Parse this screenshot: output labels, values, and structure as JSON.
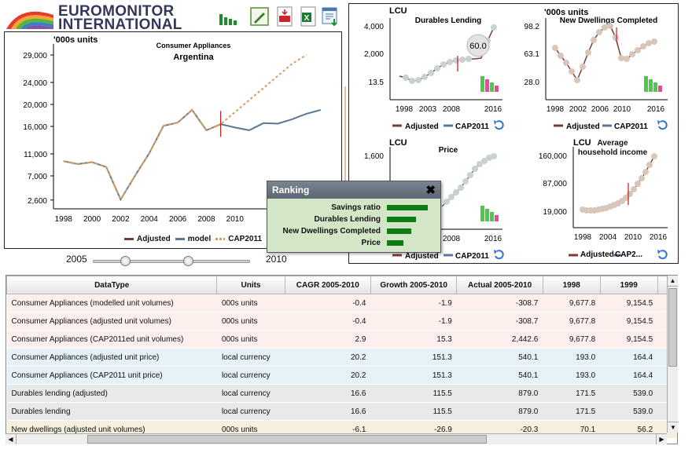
{
  "logo": {
    "line1": "EUROMONITOR",
    "line2": "INTERNATIONAL"
  },
  "toolbar": {
    "icons": [
      "bar-chart-icon",
      "edit-icon",
      "pdf-export-icon",
      "excel-export-icon",
      "download-icon"
    ]
  },
  "main_chart": {
    "unit": "'000s units",
    "title": "Consumer Appliances",
    "subtitle": "Argentina",
    "legend": [
      {
        "name": "Adjusted",
        "color": "#7e3a36"
      },
      {
        "name": "model",
        "color": "#5b7898"
      },
      {
        "name": "CAP2011",
        "color": "#d49a5c"
      }
    ]
  },
  "slider": {
    "from": "2005",
    "to": "2010",
    "handle_from_frac": 0.2,
    "handle_to_frac": 0.6
  },
  "ranking": {
    "title": "Ranking",
    "items": [
      {
        "label": "Savings ratio",
        "value": 1.0
      },
      {
        "label": "Durables Lending",
        "value": 0.72
      },
      {
        "label": "New Dwellings Completed",
        "value": 0.6
      },
      {
        "label": "Price",
        "value": 0.4
      }
    ]
  },
  "mini_charts": [
    {
      "unit": "LCU",
      "title": "Durables Lending",
      "yticks": [
        "4,000",
        "2,000",
        "13.5"
      ],
      "xticks": [
        "1998",
        "2003",
        "2008",
        "2016"
      ],
      "tooltip": "60.0",
      "legend": [
        "Adjusted",
        "CAP2011"
      ]
    },
    {
      "unit": "'000s units",
      "title": "New Dwellings Completed",
      "yticks": [
        "98.2",
        "63.1",
        "28.0"
      ],
      "xticks": [
        "1998",
        "2002",
        "2006",
        "2010",
        "2016"
      ],
      "legend": [
        "Adjusted",
        "CAP2011"
      ]
    },
    {
      "unit": "LCU",
      "title": "Price",
      "yticks": [
        "1,600"
      ],
      "xticks": [
        "2008",
        "2016"
      ],
      "legend": [
        "Adjusted",
        "CAP2011"
      ]
    },
    {
      "unit": "LCU",
      "title": "Average household income",
      "yticks": [
        "160,000",
        "87,000",
        "19,000"
      ],
      "xticks": [
        "1998",
        "2004",
        "2010",
        "2016"
      ],
      "legend": [
        "Adjusted",
        "CAP2..."
      ]
    }
  ],
  "table": {
    "columns": [
      "DataType",
      "Units",
      "CAGR 2005-2010",
      "Growth 2005-2010",
      "Actual 2005-2010",
      "1998",
      "1999"
    ],
    "rows": [
      {
        "cells": [
          "Consumer Appliances (modelled unit volumes)",
          "000s units",
          "-0.4",
          "-1.9",
          "-308.7",
          "9,677.8",
          "9,154.5"
        ],
        "bg": "#fdf0ec"
      },
      {
        "cells": [
          "Consumer Appliances (adjusted unit volumes)",
          "000s units",
          "-0.4",
          "-1.9",
          "-308.7",
          "9,677.8",
          "9,154.5"
        ],
        "bg": "#fdf0ec"
      },
      {
        "cells": [
          "Consumer Appliances (CAP2011ed unit volumes)",
          "000s units",
          "2.9",
          "15.3",
          "2,442.6",
          "9,677.8",
          "9,154.5"
        ],
        "bg": "#fdf0ec"
      },
      {
        "cells": [
          "Consumer Appliances (adjusted unit price)",
          "local currency",
          "20.2",
          "151.3",
          "540.1",
          "193.0",
          "164.4"
        ],
        "bg": "#e6f1f8"
      },
      {
        "cells": [
          "Consumer Appliances (CAP2011 unit price)",
          "local currency",
          "20.2",
          "151.3",
          "540.1",
          "193.0",
          "164.4"
        ],
        "bg": "#e6f1f8"
      },
      {
        "cells": [
          "Durables lending (adjusted)",
          "local currency",
          "16.6",
          "115.5",
          "879.0",
          "171.5",
          "539.0"
        ],
        "bg": "#e9e9e9"
      },
      {
        "cells": [
          "Durables lending",
          "local currency",
          "16.6",
          "115.5",
          "879.0",
          "171.5",
          "539.0"
        ],
        "bg": "#e9e9e9"
      },
      {
        "cells": [
          "New dwellings (adjusted unit volumes)",
          "000s units",
          "-6.1",
          "-26.9",
          "-20.3",
          "70.1",
          "56.2"
        ],
        "bg": "#f4efdf"
      }
    ]
  },
  "chart_data": [
    {
      "type": "line",
      "title": "Consumer Appliances",
      "subtitle": "Argentina",
      "ylabel": "'000s units",
      "x": [
        1998,
        1999,
        2000,
        2001,
        2002,
        2003,
        2004,
        2005,
        2006,
        2007,
        2008,
        2009,
        2010,
        2011,
        2012,
        2013,
        2014,
        2015,
        2016
      ],
      "yticks": [
        2600,
        7000,
        11000,
        16000,
        20000,
        24000,
        29000
      ],
      "xticks": [
        1998,
        2000,
        2002,
        2004,
        2006,
        2008,
        2010
      ],
      "series": [
        {
          "name": "Adjusted",
          "values": [
            9680,
            9150,
            9500,
            8600,
            2700,
            7000,
            11100,
            16100,
            16700,
            19000,
            15300,
            16400,
            null,
            null,
            null,
            null,
            null,
            null,
            null
          ]
        },
        {
          "name": "model",
          "values": [
            9680,
            9150,
            9500,
            8600,
            2700,
            7000,
            11100,
            16100,
            16700,
            19000,
            15300,
            16400,
            15800,
            15300,
            16600,
            16500,
            17300,
            18300,
            19000
          ]
        },
        {
          "name": "CAP2011",
          "values": [
            9680,
            9150,
            9500,
            8600,
            2700,
            7000,
            11100,
            16100,
            16700,
            19000,
            15300,
            16400,
            18600,
            20800,
            23000,
            25200,
            27400,
            29000,
            null
          ]
        }
      ],
      "marker_year": 2009,
      "ylim": [
        1000,
        31000
      ]
    }
  ]
}
